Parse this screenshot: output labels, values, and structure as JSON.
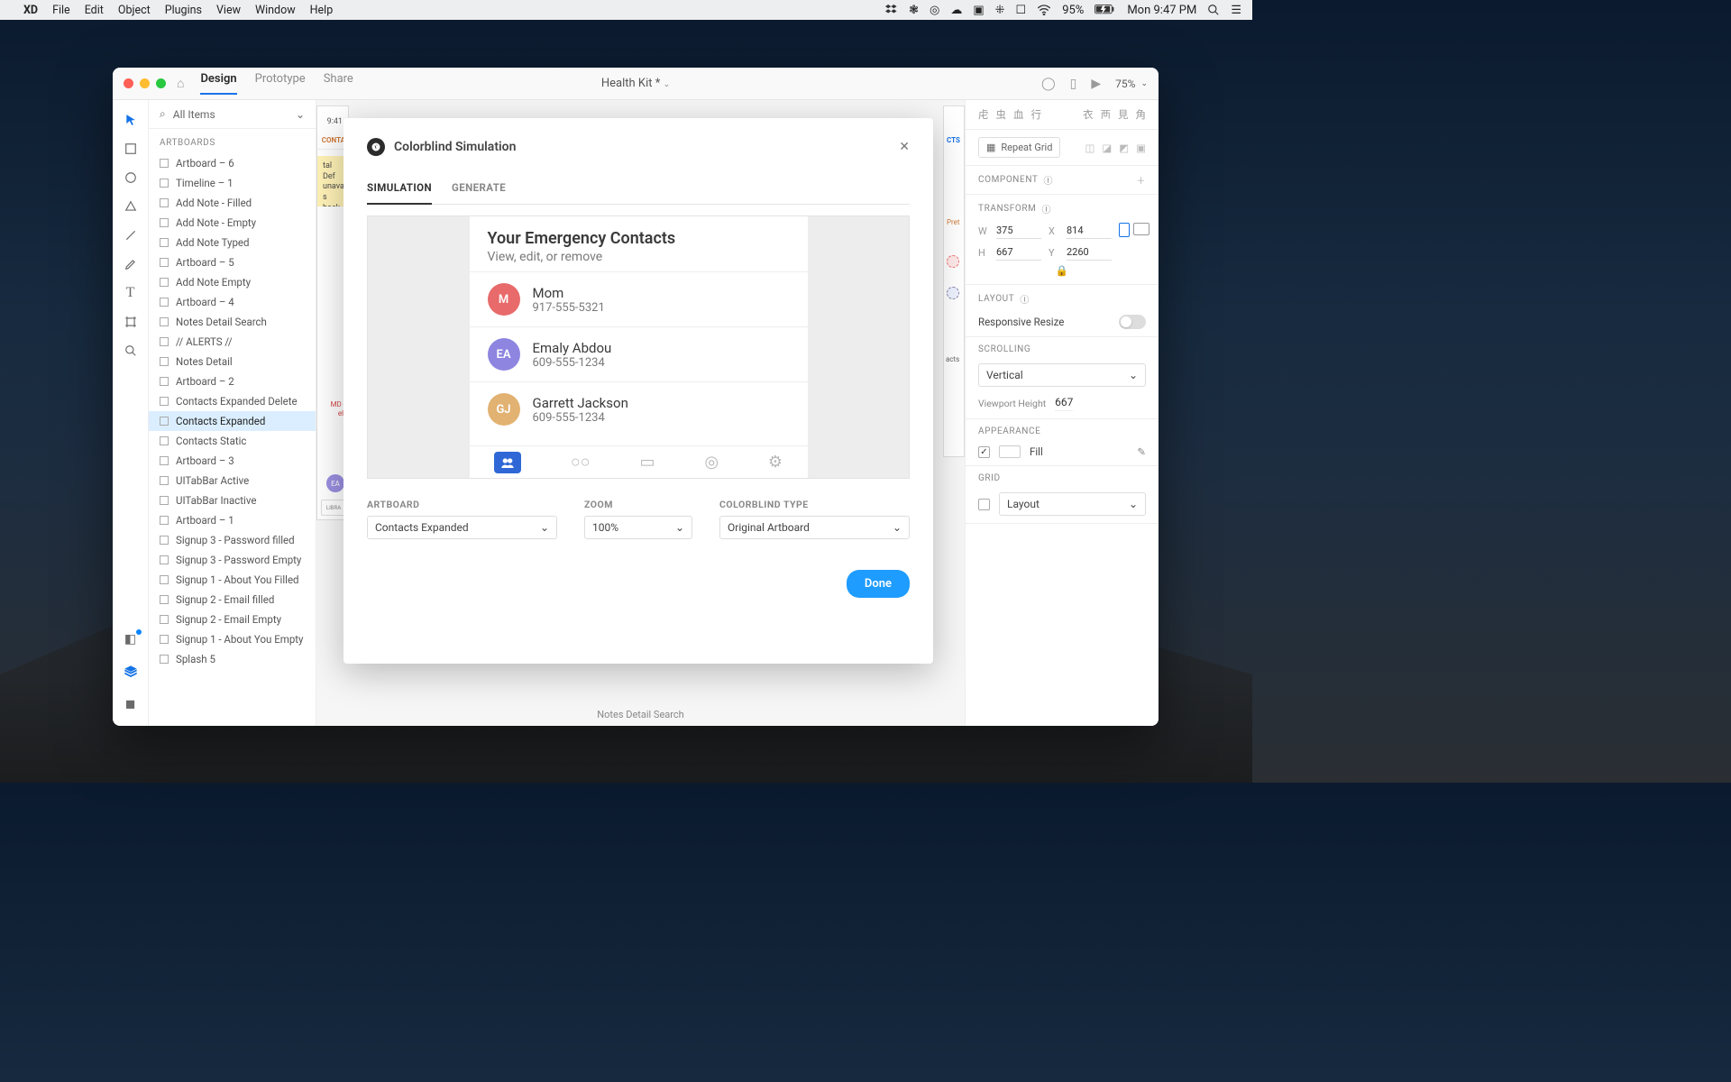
{
  "menubar": {
    "app": "XD",
    "items": [
      "File",
      "Edit",
      "Object",
      "Plugins",
      "View",
      "Window",
      "Help"
    ],
    "battery_pct": "95%",
    "clock": "Mon 9:47 PM"
  },
  "titlebar": {
    "tabs": {
      "design": "Design",
      "prototype": "Prototype",
      "share": "Share"
    },
    "doc_title": "Health Kit *",
    "zoom": "75%"
  },
  "layers": {
    "filter_label": "All Items",
    "section": "ARTBOARDS",
    "items": [
      "Artboard – 6",
      "Timeline – 1",
      "Add Note - Filled",
      "Add Note - Empty",
      "Add Note Typed",
      "Artboard – 5",
      "Add Note Empty",
      "Artboard – 4",
      "Notes Detail Search",
      "// ALERTS //",
      "Notes Detail",
      "Artboard – 2",
      "Contacts Expanded Delete",
      "Contacts Expanded",
      "Contacts Static",
      "Artboard – 3",
      "UITabBar Active",
      "UITabBar Inactive",
      "Artboard – 1",
      "Signup 3 - Password filled",
      "Signup 3 - Password Empty",
      "Signup 1 - About You Filled",
      "Signup 2 - Email filled",
      "Signup 2 - Email Empty",
      "Signup 1 - About You Empty",
      "Splash 5"
    ],
    "selected_index": 13
  },
  "canvas": {
    "footer": "Notes Detail Search",
    "peek_time": "9:41",
    "peek_header": "CONTA",
    "peek_yellow_line1": "tal Def",
    "peek_yellow_line2": "unavail",
    "peek_yellow_line3": "s back",
    "peek_red_line1": "MD -",
    "peek_red_line2": "ell",
    "peek_right_header": "CTS",
    "peek_right_text": "Pret",
    "peek_right_contacts": "acts"
  },
  "inspector": {
    "repeat_grid": "Repeat Grid",
    "component_h": "COMPONENT",
    "transform_h": "TRANSFORM",
    "W": "375",
    "X": "814",
    "H": "667",
    "Y": "2260",
    "layout_h": "LAYOUT",
    "responsive_label": "Responsive Resize",
    "scrolling_h": "SCROLLING",
    "scroll_value": "Vertical",
    "viewport_label": "Viewport Height",
    "viewport_value": "667",
    "appearance_h": "APPEARANCE",
    "fill_label": "Fill",
    "grid_h": "GRID",
    "grid_value": "Layout"
  },
  "dialog": {
    "title": "Colorblind Simulation",
    "tabs": {
      "simulation": "SIMULATION",
      "generate": "GENERATE"
    },
    "sim": {
      "heading": "Your Emergency Contacts",
      "sub": "View, edit, or remove",
      "contacts": [
        {
          "initials": "M",
          "color": "#e86a6b",
          "name": "Mom",
          "phone": "917-555-5321"
        },
        {
          "initials": "EA",
          "color": "#8d85e0",
          "name": "Emaly Abdou",
          "phone": "609-555-1234"
        },
        {
          "initials": "GJ",
          "color": "#e2b272",
          "name": "Garrett Jackson",
          "phone": "609-555-1234"
        }
      ]
    },
    "controls": {
      "artboard_label": "ARTBOARD",
      "artboard_value": "Contacts Expanded",
      "zoom_label": "Zoom",
      "zoom_value": "100%",
      "type_label": "COLORBLIND TYPE",
      "type_value": "Original Artboard",
      "done": "Done"
    }
  }
}
